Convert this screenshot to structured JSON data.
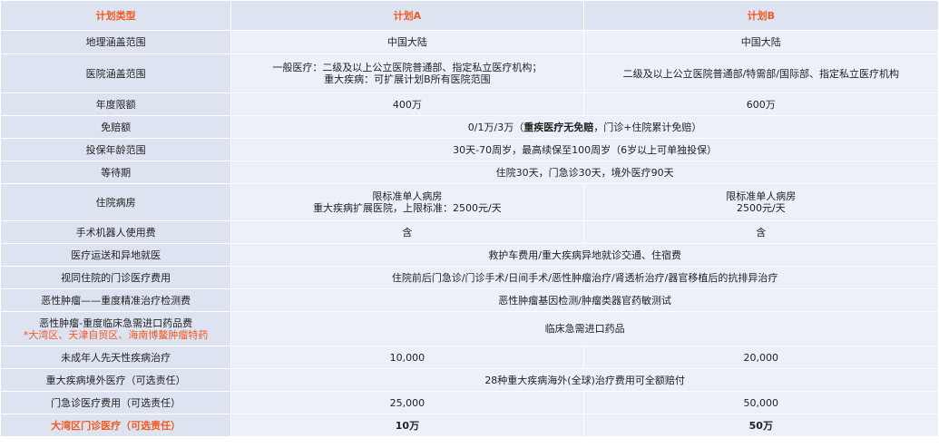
{
  "header": {
    "col0": "计划类型",
    "col1": "计划A",
    "col2": "计划B"
  },
  "rows": {
    "r1": {
      "label": "地理涵盖范围",
      "a": "中国大陆",
      "b": "中国大陆"
    },
    "r2": {
      "label": "医院涵盖范围",
      "a_line1": "一般医疗：二级及以上公立医院普通部、指定私立医疗机构；",
      "a_line2": "重大疾病：可扩展计划B所有医院范围",
      "b": "二级及以上公立医院普通部/特需部/国际部、指定私立医疗机构"
    },
    "r3": {
      "label": "年度限额",
      "a": "400万",
      "b": "600万"
    },
    "r4": {
      "label": "免赔额",
      "pre": "0/1万/3万（",
      "bold": "重疾医疗无免赔",
      "post": "，门诊+住院累计免赔）"
    },
    "r5": {
      "label": "投保年龄范围",
      "value": "30天-70周岁，最高续保至100周岁（6岁以上可单独投保）"
    },
    "r6": {
      "label": "等待期",
      "value": "住院30天，门急诊30天，境外医疗90天"
    },
    "r7": {
      "label": "住院病房",
      "a_line1": "限标准单人病房",
      "a_line2": "重大疾病扩展医院，上限标准：2500元/天",
      "b_line1": "限标准单人病房",
      "b_line2": "2500元/天"
    },
    "r8": {
      "label": "手术机器人使用费",
      "a": "含",
      "b": "含"
    },
    "r9": {
      "label": "医疗运送和异地就医",
      "value": "救护车费用/重大疾病异地就诊交通、住宿费"
    },
    "r10": {
      "label": "视同住院的门诊医疗费用",
      "value": "住院前后门急诊/门诊手术/日间手术/恶性肿瘤治疗/肾透析治疗/器官移植后的抗排异治疗"
    },
    "r11": {
      "label": "恶性肿瘤——重度精准治疗检测费",
      "value": "恶性肿瘤基因检测/肿瘤类器官药敏测试"
    },
    "r12": {
      "label": "恶性肿瘤-重度临床急需进口药品费",
      "label_note": "*大湾区、天津自贸区、海南博鳌肿瘤特药",
      "value": "临床急需进口药品"
    },
    "r13": {
      "label": "未成年人先天性疾病治疗",
      "a": "10,000",
      "b": "20,000"
    },
    "r14": {
      "label": "重大疾病境外医疗（可选责任）",
      "value": "28种重大疾病海外(全球)治疗费用可全额赔付"
    },
    "r15": {
      "label": "门急诊医疗费用（可选责任）",
      "a": "25,000",
      "b": "50,000"
    },
    "r16": {
      "label": "大湾区门诊医疗（可选责任）",
      "a": "10万",
      "b": "50万"
    }
  }
}
